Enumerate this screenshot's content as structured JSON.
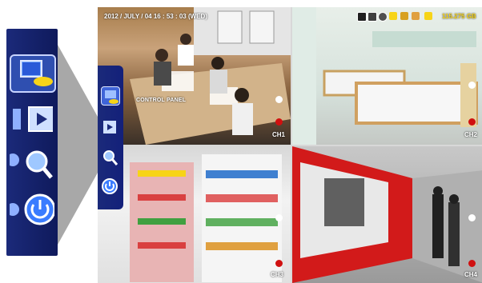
{
  "overlay": {
    "datetime": "2012 / JULY / 04  16 : 53 : 03 (WED)",
    "hdd_free": "115.275 GB",
    "menu_tooltip": "CONTROL PANEL"
  },
  "channels": [
    {
      "label": "CH1"
    },
    {
      "label": "CH2"
    },
    {
      "label": "CH3"
    },
    {
      "label": "CH4"
    }
  ],
  "menu": {
    "items": [
      {
        "icon": "control-panel-icon"
      },
      {
        "icon": "playback-icon"
      },
      {
        "icon": "search-icon"
      },
      {
        "icon": "power-icon"
      }
    ]
  },
  "status_icons": [
    "record-icon",
    "network-icon",
    "gear-icon",
    "key-icon",
    "lock-icon",
    "user-icon",
    "hdd-icon"
  ],
  "colors": {
    "menu_blue": "#1b2a7a",
    "accent_yellow": "#f7d417",
    "record_red": "#d01010"
  }
}
